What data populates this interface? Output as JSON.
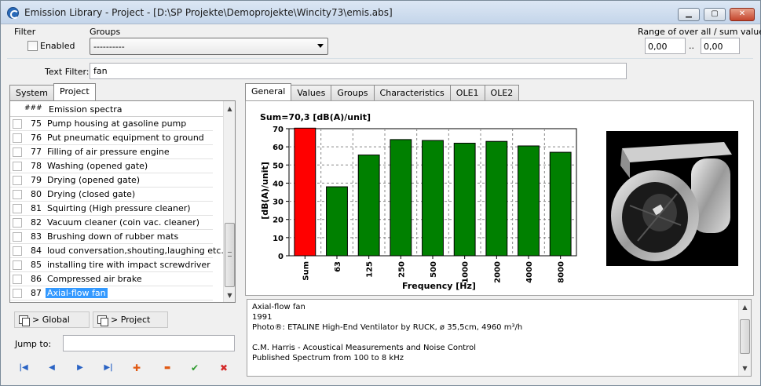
{
  "window": {
    "title": "Emission Library - Project - [D:\\SP Projekte\\Demoprojekte\\Wincity73\\emis.abs]",
    "minimize": "▁",
    "maximize": "▢",
    "close": "✕"
  },
  "filter": {
    "label": "Filter",
    "enabled_label": "Enabled",
    "enabled": false,
    "groups_label": "Groups",
    "groups_value": "----------",
    "range_label": "Range of over all / sum value",
    "range_from": "0,00",
    "range_sep": "..",
    "range_to": "0,00",
    "text_filter_label": "Text Filter:",
    "text_filter_value": "fan"
  },
  "left_tabs": [
    "System",
    "Project"
  ],
  "list": {
    "header_num": "###",
    "header_name": "Emission spectra",
    "rows": [
      {
        "num": "75",
        "name": "Pump housing at gasoline pump"
      },
      {
        "num": "76",
        "name": "Put pneumatic equipment to ground"
      },
      {
        "num": "77",
        "name": "Filling of air pressure engine"
      },
      {
        "num": "78",
        "name": "Washing (opened gate)"
      },
      {
        "num": "79",
        "name": "Drying (opened gate)"
      },
      {
        "num": "80",
        "name": "Drying (closed gate)"
      },
      {
        "num": "81",
        "name": "Squirting (High pressure cleaner)"
      },
      {
        "num": "82",
        "name": "Vacuum cleaner (coin vac. cleaner)"
      },
      {
        "num": "83",
        "name": "Brushing down of rubber mats"
      },
      {
        "num": "84",
        "name": "loud conversation,shouting,laughing etc."
      },
      {
        "num": "85",
        "name": "installing tire with impact screwdriver"
      },
      {
        "num": "86",
        "name": "Compressed air brake"
      },
      {
        "num": "87",
        "name": "Axial-flow fan"
      }
    ],
    "selected_index": 12
  },
  "buttons": {
    "global": "> Global",
    "project": "> Project",
    "jump_to_label": "Jump to:",
    "jump_to_value": ""
  },
  "nav": {
    "first": "|◀",
    "prev": "◀",
    "next": "▶",
    "last": "▶|",
    "add": "✚",
    "remove": "▬",
    "confirm": "✔",
    "cancel": "✖"
  },
  "right_tabs": [
    "General",
    "Values",
    "Groups",
    "Characteristics",
    "OLE1",
    "OLE2"
  ],
  "chart_data": {
    "type": "bar",
    "title": "Sum=70,3 [dB(A)/unit]",
    "xlabel": "Frequency [Hz]",
    "ylabel": "[dB(A)/unit]",
    "categories": [
      "Sum",
      "63",
      "125",
      "250",
      "500",
      "1000",
      "2000",
      "4000",
      "8000"
    ],
    "values": [
      70.3,
      38,
      55.5,
      64,
      63.5,
      62,
      63,
      60.5,
      57
    ],
    "colors": [
      "#ff0000",
      "#008000",
      "#008000",
      "#008000",
      "#008000",
      "#008000",
      "#008000",
      "#008000",
      "#008000"
    ],
    "ylim": [
      0,
      70
    ],
    "yticks": [
      "0",
      "10",
      "20",
      "30",
      "40",
      "50",
      "60",
      "70"
    ],
    "grid": true
  },
  "description": {
    "lines": [
      "Axial-flow fan",
      "1991",
      "Photo®:  ETALINE High-End Ventilator by RUCK, ø 35,5cm, 4960 m³/h",
      "",
      "C.M. Harris - Acoustical Measurements and Noise Control",
      "Published Spectrum from 100 to 8 kHz"
    ]
  },
  "icons": {
    "app": "app-logo-icon",
    "copy": "copy-icon"
  }
}
